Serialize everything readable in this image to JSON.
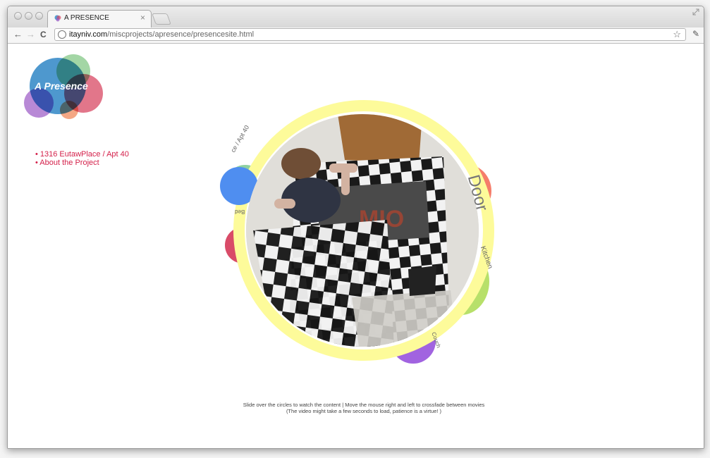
{
  "browser": {
    "tab_title": "A PRESENCE",
    "tab_close": "×",
    "url_host": "itayniv.com",
    "url_path": "/miscprojects/apresence/presencesite.html",
    "back": "←",
    "forward": "→",
    "reload": "C",
    "star": "☆",
    "wrench": "✎"
  },
  "logo": {
    "text": "A Presence",
    "colors": [
      "#2f86c6",
      "#8ccc8e",
      "#d94862",
      "#9a56c5",
      "#f08a5a"
    ]
  },
  "menu": {
    "items": [
      "• 1316 EutawPlace / Apt 40",
      "• About the Project"
    ]
  },
  "viewer": {
    "labels": {
      "apt": "ce / Apt 40",
      "bed": "Bed",
      "door": "Door",
      "kitchen": "Kitchen",
      "couch": "Couch"
    },
    "colors": {
      "ring": "#fdfb9a",
      "apt": "#4f8ef0",
      "bed_green": "#8fd1a0",
      "bed_red": "#d94b68",
      "door": "#f57d6a",
      "kitchen": "#b7e06a",
      "couch": "#a163e0"
    }
  },
  "instructions": {
    "line1": "Slide over the circles to watch the content | Move the mouse right and left to crossfade between movies",
    "line2": "(The video might take a few seconds to load, patience is a virtue! )"
  }
}
